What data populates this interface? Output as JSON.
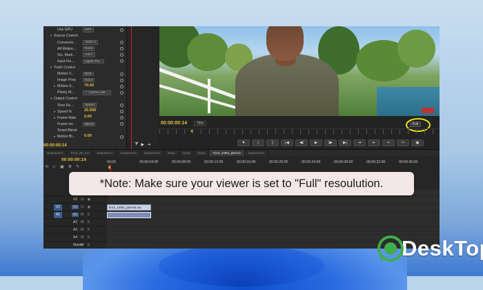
{
  "effect_controls": {
    "rows": [
      {
        "twirl": "",
        "label": "Use GPU",
        "value": "OFF"
      },
      {
        "twirl": "▾",
        "label": "Source Control",
        "value": ""
      },
      {
        "twirl": "",
        "label": "Conversio...",
        "value": "Video 1"
      },
      {
        "twirl": "",
        "label": "Alt Motion...",
        "value": "None"
      },
      {
        "twirl": "",
        "label": "Src. Mark...",
        "value": "Cut A"
      },
      {
        "twirl": "",
        "label": "Input Fie...",
        "value": "Upper Fie..."
      },
      {
        "twirl": "▾",
        "label": "Track Control",
        "value": ""
      },
      {
        "twirl": "",
        "label": "Motion V...",
        "value": "Best"
      },
      {
        "twirl": "",
        "label": "Image Prep",
        "value": "None"
      },
      {
        "twirl": "▸",
        "label": "Motion S...",
        "value": "70.00"
      },
      {
        "twirl": "",
        "label": "Plenty M...",
        "value": "✓ Cache Last ..."
      },
      {
        "twirl": "▾",
        "label": "Output Control",
        "value": ""
      },
      {
        "twirl": "",
        "label": "Time Re...",
        "value": "Speed"
      },
      {
        "twirl": "▸",
        "label": "Speed %",
        "value": "25.000"
      },
      {
        "twirl": "▸",
        "label": "Frame Rate",
        "value": "0.00"
      },
      {
        "twirl": "",
        "label": "Frame Int...",
        "value": "Blend"
      },
      {
        "twirl": "",
        "label": "Smart Blend",
        "value": ""
      },
      {
        "twirl": "▸",
        "label": "Motion Bl...",
        "value": "0.00"
      }
    ],
    "timecode": "00:00:00:14"
  },
  "monitor": {
    "timecode": "00:00:00:14",
    "fit": "75%",
    "resolution": "Full",
    "transport": [
      "▼",
      "{",
      "}",
      "|◀",
      "◀|",
      "▶",
      "|▶",
      "▶|",
      "⇥",
      "⇤",
      "⇦",
      "⇨",
      "▣"
    ]
  },
  "tabs": [
    "Sequence1",
    "Tim3_4K_sm",
    "Sequence1",
    "Sequence2",
    "Sequence3",
    "Seq1",
    "Seq2",
    "Seq3",
    "Tim3_1080i_pierre2",
    "Sequence4"
  ],
  "timeline": {
    "timecode": "00:00:00:14",
    "ticks": [
      "00:00",
      "00:00:04:00",
      "00:00:08:00",
      "00:00:12:00",
      "00:00:16:00",
      "00:00:20:00",
      "00:00:24:00",
      "00:00:28:00",
      "00:00:32:00",
      "00:00:36:00"
    ],
    "tracks": [
      {
        "patch": "",
        "label": "V3"
      },
      {
        "patch": "",
        "label": "V2"
      },
      {
        "patch": "V1",
        "label": "V1"
      },
      {
        "patch": "A1",
        "label": "A1"
      },
      {
        "patch": "",
        "label": "A2"
      },
      {
        "patch": "",
        "label": "A3"
      },
      {
        "patch": "",
        "label": "A4"
      },
      {
        "patch": "",
        "label": "Master"
      }
    ],
    "video_clip": "tim3_1080i_pierre2.mx",
    "audio_clip": ""
  },
  "note": "*Note: Make sure your viewer is set to \"Full\" resoulution.",
  "watermark": {
    "brand": "DeskTop",
    "color": "#ffffff"
  },
  "colors": {
    "timecode": "#e8c23a",
    "playhead": "#c52b2b",
    "highlight": "#e6e21e"
  }
}
